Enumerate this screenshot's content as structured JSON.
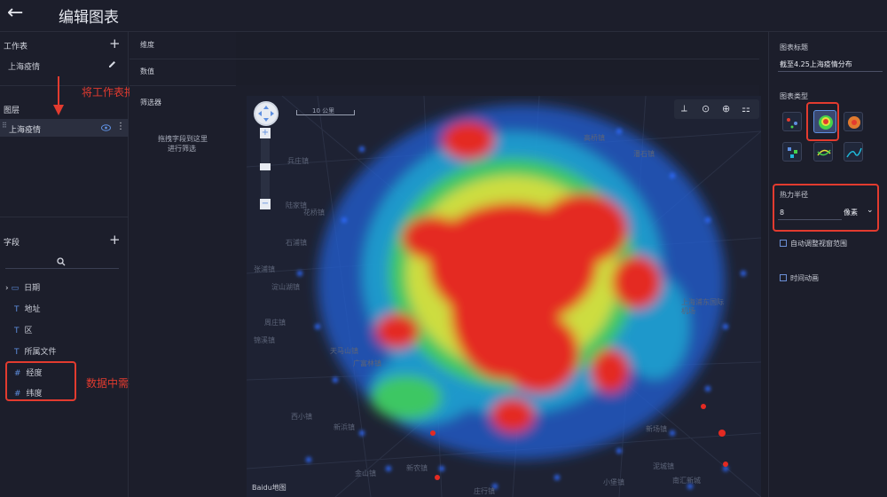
{
  "header": {
    "back_icon": "arrow-left",
    "title": "编辑图表"
  },
  "left": {
    "worksheet_title": "工作表",
    "worksheet_item": "上海疫情",
    "layer_title": "图层",
    "layer_item": "上海疫情",
    "fields_title": "字段",
    "fields": [
      {
        "icon": "calendar",
        "label": "日期",
        "type": "date"
      },
      {
        "icon": "T",
        "label": "地址",
        "type": "text"
      },
      {
        "icon": "T",
        "label": "区",
        "type": "text"
      },
      {
        "icon": "T",
        "label": "所属文件",
        "type": "text"
      },
      {
        "icon": "#",
        "label": "经度",
        "type": "number"
      },
      {
        "icon": "#",
        "label": "纬度",
        "type": "number"
      }
    ]
  },
  "middle": {
    "dimension_label": "维度",
    "value_label": "数值",
    "filter_label": "筛选器",
    "drag_hint_line1": "拖拽字段到这里",
    "drag_hint_line2": "进行筛选"
  },
  "annotations": {
    "drag_hint": "将工作表拖入图层",
    "field_hint": "数据中需要有经度和纬度字段"
  },
  "map": {
    "scale_label": "10 公里",
    "attribution": "Baidu地图",
    "place_labels": [
      "兵庄镇",
      "花桥镇",
      "陆家镇",
      "石浦镇",
      "淀山湖镇",
      "张浦镇",
      "周庄镇",
      "天马山镇",
      "锦溪镇",
      "西小镇",
      "广富林镇",
      "新浜镇",
      "新农镇",
      "庄行镇",
      "小堡镇",
      "新场镇",
      "上海浦东国际机场",
      "金山镇",
      "高桥镇",
      "潘石镇",
      "泥城镇",
      "南汇新城"
    ]
  },
  "right": {
    "chart_title_label": "图表标题",
    "chart_title_value": "截至4.25上海疫情分布",
    "chart_type_label": "图表类型",
    "heat_radius_label": "热力半径",
    "heat_radius_value": "8",
    "unit_label": "像素",
    "auto_fit_label": "自动调整视窗范围",
    "time_anim_label": "时间动画"
  },
  "colors": {
    "accent": "#5e8fe0",
    "annotation_red": "#e23b2f",
    "panel_bg": "#1c1e2b",
    "map_bg": "#1e2233"
  }
}
